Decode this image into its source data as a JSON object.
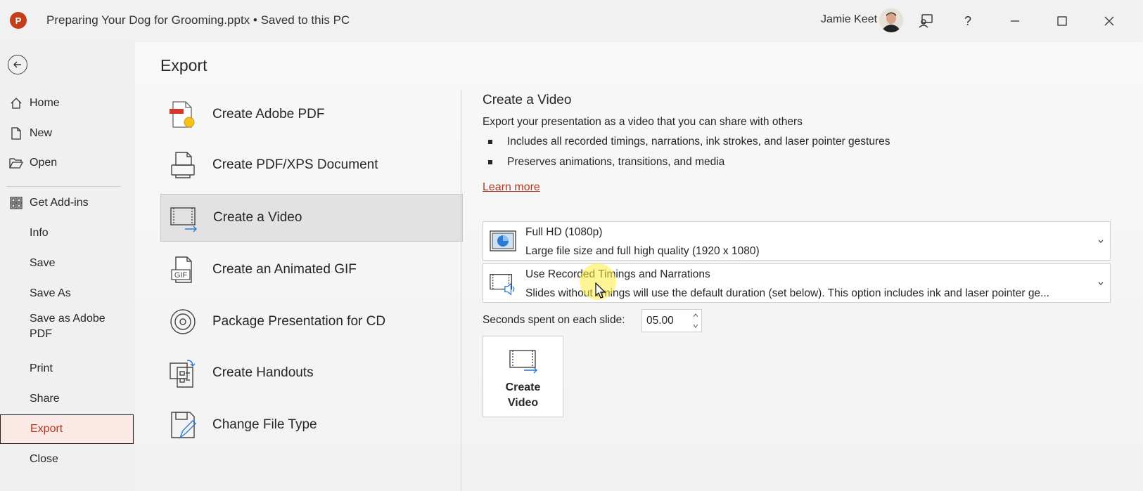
{
  "titlebar": {
    "app_logo": "P",
    "document_title": "Preparing Your Dog for Grooming.pptx • Saved to this PC",
    "user_name": "Jamie Keet",
    "help_glyph": "?"
  },
  "nav": {
    "items": [
      {
        "label": "Home",
        "icon": "home-icon"
      },
      {
        "label": "New",
        "icon": "new-document-icon"
      },
      {
        "label": "Open",
        "icon": "open-folder-icon"
      },
      {
        "label": "Get Add-ins",
        "icon": "add-ins-icon"
      },
      {
        "label": "Info"
      },
      {
        "label": "Save"
      },
      {
        "label": "Save As"
      },
      {
        "label": "Save as Adobe PDF"
      },
      {
        "label": "Print"
      },
      {
        "label": "Share"
      },
      {
        "label": "Export",
        "selected": true
      },
      {
        "label": "Close"
      }
    ]
  },
  "export": {
    "title": "Export",
    "options": [
      {
        "label": "Create Adobe PDF",
        "icon": "adobe-pdf-icon"
      },
      {
        "label": "Create PDF/XPS Document",
        "icon": "pdf-xps-icon"
      },
      {
        "label": "Create a Video",
        "icon": "video-icon",
        "selected": true
      },
      {
        "label": "Create an Animated GIF",
        "icon": "gif-icon",
        "icon_text": "GIF"
      },
      {
        "label": "Package Presentation for CD",
        "icon": "cd-icon"
      },
      {
        "label": "Create Handouts",
        "icon": "handouts-icon"
      },
      {
        "label": "Change File Type",
        "icon": "change-file-type-icon"
      }
    ]
  },
  "video_pane": {
    "title": "Create a Video",
    "description": "Export your presentation as a video that you can share with others",
    "bullets": [
      "Includes all recorded timings, narrations, ink strokes, and laser pointer gestures",
      "Preserves animations, transitions, and media"
    ],
    "learn_more": "Learn more",
    "quality_dropdown": {
      "line1": "Full HD (1080p)",
      "line2": "Large file size and full high quality (1920 x 1080)"
    },
    "timings_dropdown": {
      "line1": "Use Recorded Timings and Narrations",
      "line2": "Slides without timings will use the default duration (set below). This option includes ink and laser pointer ge..."
    },
    "seconds_label": "Seconds spent on each slide:",
    "seconds_value": "05.00",
    "create_button": {
      "line1": "Create",
      "line2": "Video"
    }
  },
  "colors": {
    "accent": "#b5361c",
    "selected_nav_bg": "#fbe9e5",
    "selected_option_bg": "#e2e2e2"
  }
}
